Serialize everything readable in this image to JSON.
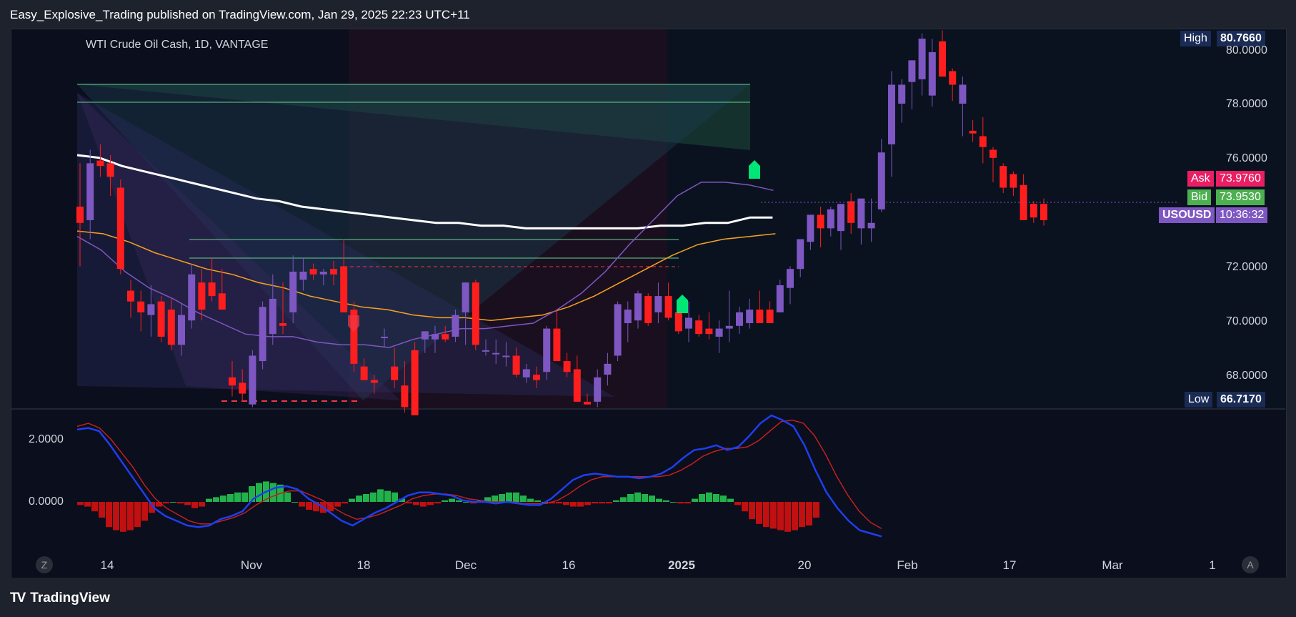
{
  "header": {
    "publisher_text": "Easy_Explosive_Trading published on TradingView.com, Jan 29, 2025 22:23 UTC+11"
  },
  "symbol_label": "WTI Crude Oil Cash, 1D, VANTAGE",
  "footer": {
    "logo_text": "TradingView",
    "z_button": "Z",
    "a_button": "A"
  },
  "price_tags": {
    "high": {
      "label": "High",
      "value": "80.7660"
    },
    "low": {
      "label": "Low",
      "value": "66.7170"
    },
    "ask": {
      "label": "Ask",
      "value": "73.9760"
    },
    "bid": {
      "label": "Bid",
      "value": "73.9530"
    },
    "symbol": {
      "label": "USOUSD",
      "value": "10:36:32"
    }
  },
  "colors": {
    "bull": "#7e57c2",
    "bear": "#ff1e1e",
    "ma200": "#ffffff",
    "ma_orange": "#f6a21e",
    "ma_purple": "#7e57c2",
    "macd": "#1e3ff0",
    "signal": "#c02020",
    "hist_pos": "#22b24c",
    "hist_neg": "#c01010"
  },
  "chart_data": [
    {
      "type": "candlestick",
      "title": "WTI Crude Oil Cash, 1D, VANTAGE",
      "x_tick_labels": [
        "14",
        "Nov",
        "18",
        "Dec",
        "16",
        "2025",
        "20",
        "Feb",
        "17",
        "Mar",
        "1"
      ],
      "y_tick_labels": [
        "80.0000",
        "78.0000",
        "76.0000",
        "72.0000",
        "70.0000",
        "68.0000"
      ],
      "ylim": [
        66.6,
        80.8
      ],
      "candles_ohlc": [
        [
          74.3,
          75.9,
          72.1,
          73.7
        ],
        [
          73.8,
          76.4,
          73.1,
          75.9
        ],
        [
          76.0,
          76.6,
          75.4,
          75.8
        ],
        [
          75.9,
          76.2,
          74.7,
          75.4
        ],
        [
          75.0,
          75.3,
          71.8,
          72.0
        ],
        [
          71.2,
          71.6,
          70.2,
          70.8
        ],
        [
          70.8,
          71.2,
          69.7,
          70.4
        ],
        [
          70.3,
          71.4,
          69.5,
          70.7
        ],
        [
          70.8,
          71.0,
          69.3,
          69.5
        ],
        [
          70.5,
          70.9,
          69.0,
          69.2
        ],
        [
          69.2,
          70.7,
          68.8,
          70.3
        ],
        [
          70.1,
          72.2,
          69.8,
          71.8
        ],
        [
          71.5,
          72.0,
          70.1,
          70.5
        ],
        [
          71.5,
          72.4,
          70.8,
          71.0
        ],
        [
          71.1,
          72.0,
          70.5,
          70.5
        ],
        [
          68.0,
          68.6,
          67.3,
          67.7
        ],
        [
          67.8,
          68.3,
          67.1,
          67.4
        ],
        [
          67.0,
          69.0,
          66.9,
          68.8
        ],
        [
          68.6,
          70.8,
          68.3,
          70.6
        ],
        [
          69.6,
          71.8,
          69.2,
          70.9
        ],
        [
          70.0,
          71.5,
          69.6,
          69.9
        ],
        [
          70.4,
          72.5,
          70.0,
          71.9
        ],
        [
          71.6,
          72.4,
          71.2,
          71.9
        ],
        [
          72.0,
          72.2,
          71.6,
          71.8
        ],
        [
          71.8,
          72.0,
          71.4,
          71.9
        ],
        [
          72.0,
          72.3,
          71.4,
          71.8
        ],
        [
          72.1,
          73.1,
          70.4,
          70.4
        ],
        [
          70.5,
          70.8,
          68.2,
          68.5
        ],
        [
          68.4,
          68.7,
          67.9,
          67.9
        ],
        [
          67.9,
          68.1,
          67.4,
          67.8
        ],
        [
          69.5,
          69.8,
          69.1,
          69.5
        ],
        [
          68.4,
          69.1,
          67.6,
          67.9
        ],
        [
          67.7,
          68.6,
          66.7,
          66.9
        ],
        [
          69.0,
          69.3,
          66.6,
          66.6
        ],
        [
          69.4,
          69.6,
          68.9,
          69.7
        ],
        [
          69.4,
          69.9,
          68.9,
          69.6
        ],
        [
          69.6,
          69.9,
          69.3,
          69.4
        ],
        [
          69.5,
          70.5,
          69.3,
          70.3
        ],
        [
          70.4,
          71.5,
          69.2,
          71.5
        ],
        [
          71.5,
          71.6,
          69.0,
          69.2
        ],
        [
          69.0,
          69.4,
          68.8,
          69.0
        ],
        [
          68.9,
          69.4,
          68.5,
          68.9
        ],
        [
          68.8,
          69.3,
          68.4,
          68.8
        ],
        [
          68.8,
          69.1,
          68.0,
          68.1
        ],
        [
          68.0,
          68.5,
          67.8,
          68.3
        ],
        [
          68.1,
          68.4,
          67.6,
          67.9
        ],
        [
          68.2,
          69.9,
          67.9,
          69.8
        ],
        [
          69.8,
          70.5,
          68.7,
          68.6
        ],
        [
          68.6,
          68.9,
          68.0,
          68.2
        ],
        [
          68.3,
          68.8,
          67.1,
          67.1
        ],
        [
          67.1,
          67.4,
          67.0,
          67.0
        ],
        [
          67.1,
          68.3,
          66.9,
          68.0
        ],
        [
          68.1,
          68.9,
          67.7,
          68.5
        ],
        [
          68.8,
          70.8,
          68.6,
          70.7
        ],
        [
          70.0,
          70.8,
          69.3,
          70.5
        ],
        [
          70.1,
          71.2,
          69.8,
          71.1
        ],
        [
          71.0,
          71.1,
          69.9,
          70.0
        ],
        [
          70.4,
          71.5,
          70.0,
          71.0
        ],
        [
          71.0,
          71.5,
          70.1,
          70.2
        ],
        [
          70.4,
          70.6,
          69.6,
          69.7
        ],
        [
          69.8,
          70.8,
          69.3,
          70.2
        ],
        [
          70.1,
          70.3,
          69.5,
          69.6
        ],
        [
          69.8,
          70.4,
          69.4,
          69.6
        ],
        [
          69.5,
          70.1,
          68.9,
          69.8
        ],
        [
          69.8,
          71.2,
          69.3,
          69.9
        ],
        [
          69.9,
          70.6,
          69.6,
          70.4
        ],
        [
          70.0,
          70.9,
          69.8,
          70.5
        ],
        [
          70.5,
          71.2,
          70.0,
          70.0
        ],
        [
          70.5,
          70.8,
          70.0,
          70.0
        ],
        [
          70.4,
          71.6,
          70.4,
          71.4
        ],
        [
          71.3,
          72.1,
          70.7,
          72.0
        ],
        [
          72.0,
          73.1,
          71.7,
          73.1
        ],
        [
          73.0,
          74.0,
          72.7,
          74.0
        ],
        [
          74.0,
          74.3,
          72.8,
          73.5
        ],
        [
          73.5,
          74.3,
          73.2,
          74.2
        ],
        [
          73.4,
          74.4,
          72.7,
          74.4
        ],
        [
          74.5,
          74.8,
          73.3,
          73.7
        ],
        [
          73.5,
          74.6,
          72.9,
          74.6
        ],
        [
          73.5,
          74.6,
          73.0,
          73.7
        ],
        [
          74.2,
          76.8,
          74.1,
          76.3
        ],
        [
          76.6,
          79.3,
          75.4,
          78.8
        ],
        [
          78.1,
          79.0,
          77.4,
          78.8
        ],
        [
          78.9,
          79.7,
          77.9,
          79.7
        ],
        [
          79.0,
          80.7,
          78.4,
          80.5
        ],
        [
          78.4,
          80.5,
          78.0,
          80.0
        ],
        [
          80.4,
          80.8,
          79.1,
          79.1
        ],
        [
          79.3,
          79.4,
          78.2,
          78.8
        ],
        [
          78.1,
          79.1,
          76.9,
          78.8
        ],
        [
          77.1,
          77.5,
          76.7,
          77.0
        ],
        [
          76.9,
          77.6,
          75.9,
          76.5
        ],
        [
          76.4,
          76.5,
          75.2,
          76.1
        ],
        [
          75.8,
          75.9,
          74.8,
          75.0
        ],
        [
          75.5,
          75.6,
          74.7,
          75.0
        ],
        [
          75.1,
          75.5,
          73.8,
          73.8
        ],
        [
          74.4,
          74.5,
          73.7,
          73.9
        ],
        [
          74.4,
          74.6,
          73.6,
          73.8
        ]
      ],
      "series": [
        {
          "name": "MA 200",
          "values": [
            76.2,
            76.1,
            75.8,
            75.6,
            75.4,
            75.2,
            75.0,
            74.8,
            74.6,
            74.5,
            74.3,
            74.2,
            74.1,
            74.0,
            73.9,
            73.8,
            73.7,
            73.7,
            73.6,
            73.6,
            73.5,
            73.5,
            73.5,
            73.5,
            73.5,
            73.5,
            73.6,
            73.6,
            73.7,
            73.7,
            73.9,
            73.9
          ]
        },
        {
          "name": "MA 50",
          "values": [
            73.4,
            73.3,
            73.0,
            72.6,
            72.3,
            72.0,
            71.8,
            71.5,
            71.3,
            71.0,
            70.8,
            70.6,
            70.5,
            70.3,
            70.2,
            70.2,
            70.1,
            70.2,
            70.3,
            70.6,
            71.0,
            71.5,
            72.0,
            72.5,
            72.9,
            73.1,
            73.2,
            73.3
          ]
        },
        {
          "name": "MA 20",
          "values": [
            73.2,
            72.7,
            71.9,
            71.3,
            70.9,
            70.4,
            70.0,
            69.6,
            69.5,
            69.5,
            69.3,
            69.2,
            69.2,
            69.1,
            69.4,
            69.6,
            69.8,
            69.8,
            69.9,
            70.0,
            70.5,
            71.1,
            71.9,
            72.9,
            73.8,
            74.7,
            75.2,
            75.2,
            75.1,
            74.9
          ]
        }
      ]
    },
    {
      "type": "macd",
      "y_tick_labels": [
        "2.0000",
        "0.0000"
      ],
      "ylim": [
        -1.9,
        2.9
      ],
      "macd": [
        2.3,
        2.35,
        2.25,
        1.8,
        1.3,
        0.8,
        0.3,
        -0.2,
        -0.45,
        -0.6,
        -0.75,
        -0.8,
        -0.75,
        -0.55,
        -0.45,
        -0.3,
        0.1,
        0.3,
        0.45,
        0.5,
        0.4,
        0.1,
        -0.1,
        -0.35,
        -0.6,
        -0.75,
        -0.55,
        -0.35,
        -0.2,
        0.0,
        0.2,
        0.3,
        0.3,
        0.25,
        0.2,
        0.05,
        0.0,
        0.0,
        -0.05,
        0.0,
        -0.05,
        -0.1,
        -0.1,
        0.1,
        0.4,
        0.7,
        0.85,
        0.9,
        0.85,
        0.8,
        0.8,
        0.75,
        0.8,
        0.9,
        1.1,
        1.4,
        1.65,
        1.7,
        1.8,
        1.65,
        1.75,
        2.1,
        2.5,
        2.75,
        2.6,
        2.4,
        1.8,
        1.0,
        0.3,
        -0.2,
        -0.6,
        -0.9,
        -1.0,
        -1.1
      ],
      "signal": [
        2.4,
        2.5,
        2.35,
        2.0,
        1.55,
        1.1,
        0.55,
        0.1,
        -0.2,
        -0.4,
        -0.6,
        -0.7,
        -0.7,
        -0.6,
        -0.5,
        -0.35,
        -0.1,
        0.1,
        0.25,
        0.35,
        0.35,
        0.2,
        0.05,
        -0.2,
        -0.4,
        -0.55,
        -0.5,
        -0.4,
        -0.25,
        -0.1,
        0.1,
        0.2,
        0.25,
        0.25,
        0.2,
        0.1,
        0.05,
        0.0,
        0.0,
        0.0,
        -0.05,
        -0.05,
        -0.05,
        0.05,
        0.25,
        0.5,
        0.7,
        0.8,
        0.8,
        0.8,
        0.8,
        0.8,
        0.8,
        0.85,
        1.0,
        1.2,
        1.45,
        1.6,
        1.7,
        1.7,
        1.75,
        1.95,
        2.25,
        2.55,
        2.6,
        2.5,
        2.1,
        1.5,
        0.8,
        0.2,
        -0.3,
        -0.65,
        -0.85
      ],
      "histogram": [
        -0.1,
        -0.15,
        -0.3,
        -0.5,
        -0.8,
        -0.9,
        -0.95,
        -0.9,
        -0.8,
        -0.6,
        -0.35,
        -0.15,
        -0.05,
        0.0,
        -0.05,
        -0.1,
        -0.2,
        -0.15,
        0.1,
        0.15,
        0.2,
        0.25,
        0.3,
        0.3,
        0.5,
        0.6,
        0.65,
        0.6,
        0.55,
        0.3,
        0.0,
        -0.15,
        -0.25,
        -0.3,
        -0.35,
        -0.3,
        -0.15,
        -0.05,
        0.1,
        0.2,
        0.25,
        0.3,
        0.4,
        0.35,
        0.3,
        0.1,
        -0.05,
        -0.1,
        -0.15,
        -0.1,
        -0.05,
        0.05,
        0.1,
        0.05,
        0.0,
        -0.05,
        0.05,
        0.15,
        0.2,
        0.25,
        0.3,
        0.3,
        0.2,
        0.1,
        0.05,
        0.0,
        -0.05,
        -0.05,
        -0.1,
        -0.15,
        -0.15,
        -0.1,
        -0.05,
        -0.05,
        -0.05,
        0.05,
        0.15,
        0.25,
        0.3,
        0.25,
        0.2,
        0.1,
        0.05,
        0.0,
        -0.05,
        -0.05,
        0.1,
        0.25,
        0.3,
        0.25,
        0.2,
        0.1,
        -0.1,
        -0.3,
        -0.55,
        -0.7,
        -0.8,
        -0.85,
        -0.9,
        -0.95,
        -0.9,
        -0.8,
        -0.75,
        -0.5
      ]
    }
  ]
}
